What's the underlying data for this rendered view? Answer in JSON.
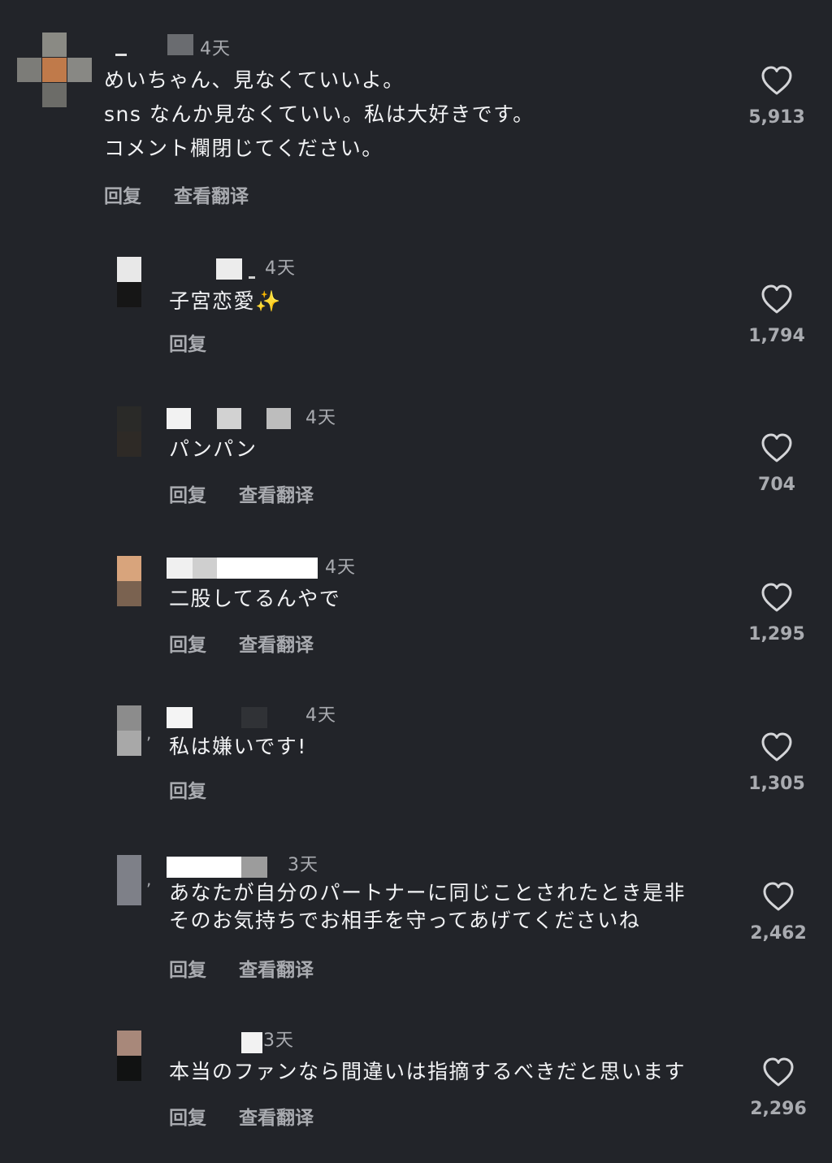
{
  "comments": [
    {
      "time": "4天",
      "lines": [
        "めいちゃん、見なくていいよ。",
        "sns なんか見なくていい。私は大好きです。",
        "コメント欄閉じてください。"
      ],
      "reply": "回复",
      "translate": "查看翻译",
      "likes": "5,913"
    },
    {
      "time": "4天",
      "lines": [
        "子宮恋愛✨"
      ],
      "reply": "回复",
      "translate": "",
      "likes": "1,794"
    },
    {
      "time": "4天",
      "lines": [
        "パンパン"
      ],
      "reply": "回复",
      "translate": "查看翻译",
      "likes": "704"
    },
    {
      "time": "4天",
      "lines": [
        "二股してるんやで"
      ],
      "reply": "回复",
      "translate": "查看翻译",
      "likes": "1,295"
    },
    {
      "time": "4天",
      "lines": [
        "私は嫌いです!"
      ],
      "reply": "回复",
      "translate": "",
      "likes": "1,305"
    },
    {
      "time": "3天",
      "lines": [
        "あなたが自分のパートナーに同じことされたとき是非",
        "そのお気持ちでお相手を守ってあげてくださいね"
      ],
      "reply": "回复",
      "translate": "查看翻译",
      "likes": "2,462"
    },
    {
      "time": "3天",
      "lines": [
        "本当のファンなら間違いは指摘するべきだと思います"
      ],
      "reply": "回复",
      "translate": "查看翻译",
      "likes": "2,296"
    }
  ],
  "icons": {
    "like": "heart-outline-icon"
  },
  "colors": {
    "background": "#222429",
    "text": "#f2f3f5",
    "muted": "#a9abb0"
  }
}
